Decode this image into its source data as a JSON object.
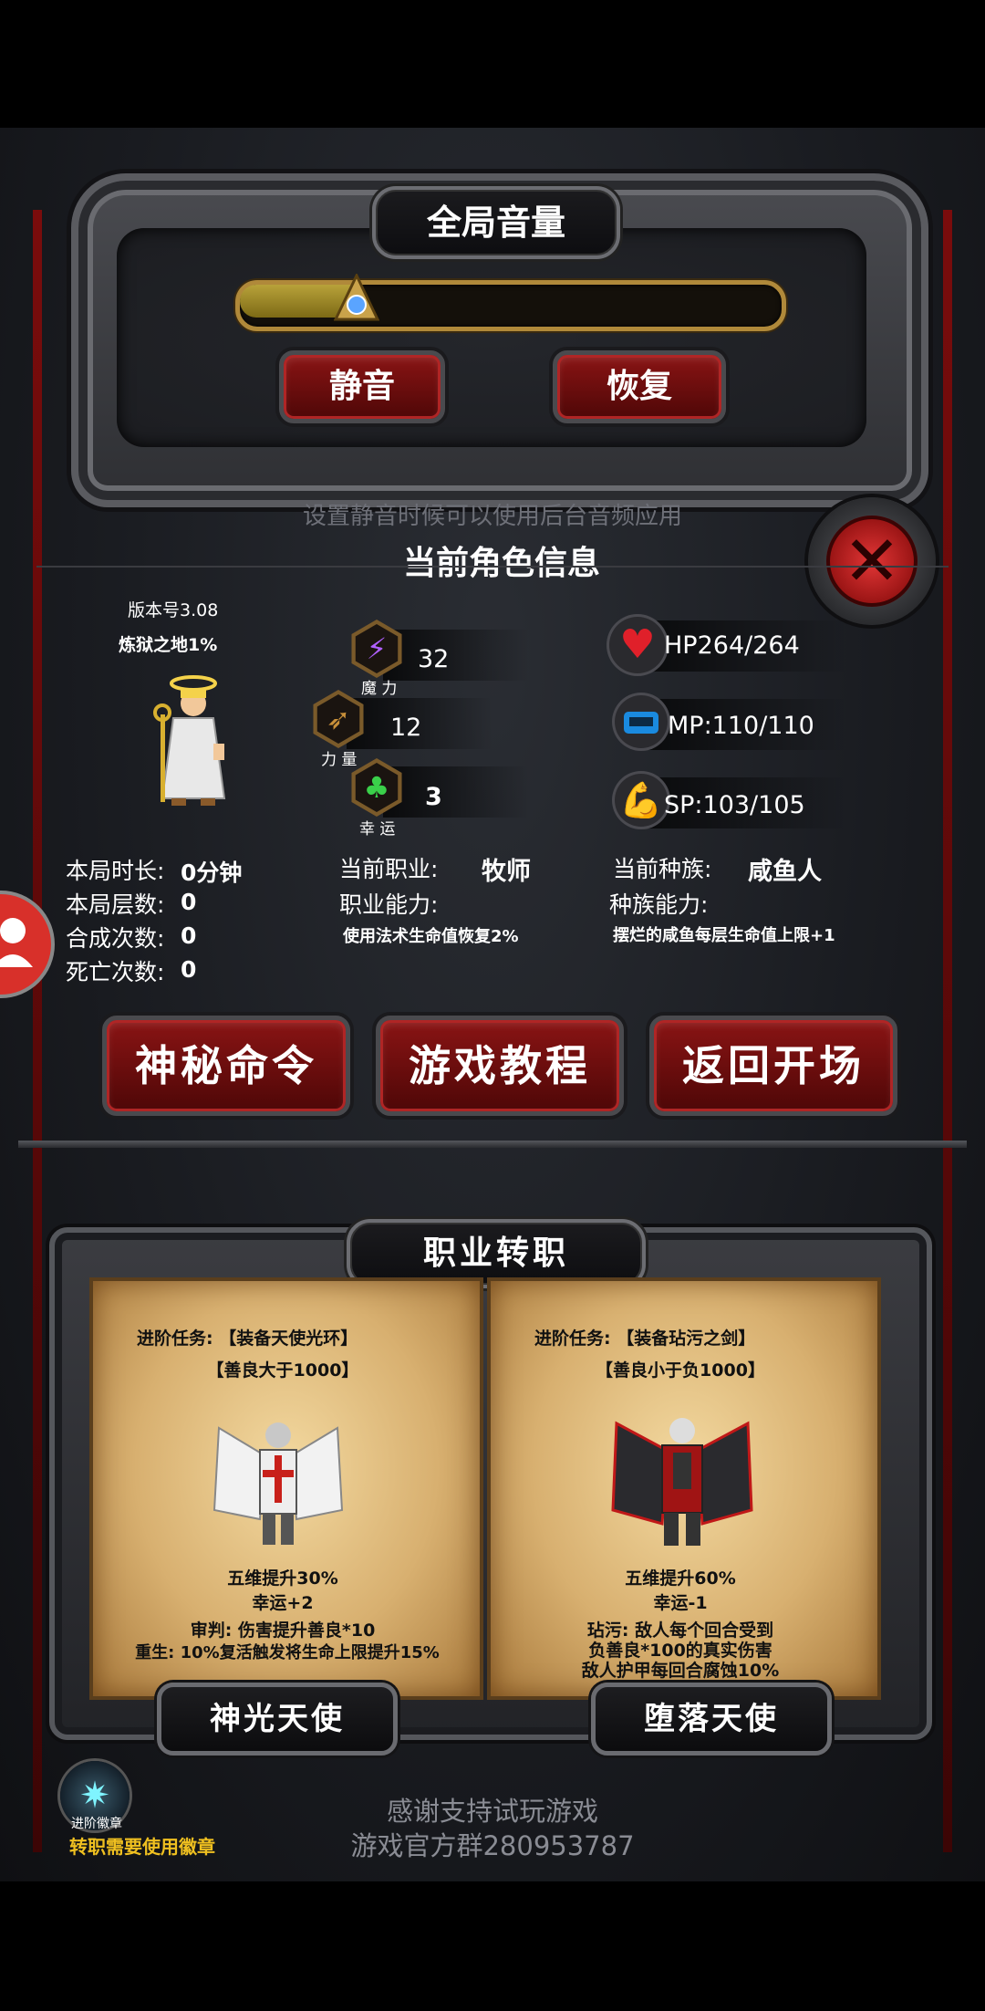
{
  "volume": {
    "title": "全局音量",
    "level": 0.22,
    "mute_label": "静音",
    "restore_label": "恢复",
    "hint": "设置静音时候可以使用后台音频应用"
  },
  "char_info": {
    "title": "当前角色信息",
    "version": "版本号3.08",
    "difficulty": "炼狱之地1%",
    "stats": {
      "magic": {
        "value": "32",
        "label": "魔 力",
        "icon": "lightning-icon"
      },
      "strength": {
        "value": "12",
        "label": "力 量",
        "icon": "bow-icon"
      },
      "luck": {
        "value": "3",
        "label": "幸 运",
        "icon": "clover-icon"
      },
      "hp": {
        "value": "HP264/264",
        "icon": "heart-icon"
      },
      "mp": {
        "value": "MP:110/110",
        "icon": "mp-icon"
      },
      "sp": {
        "value": "SP:103/105",
        "icon": "muscle-icon"
      }
    },
    "records": [
      {
        "label": "本局时长:",
        "value": "0分钟"
      },
      {
        "label": "本局层数:",
        "value": "0"
      },
      {
        "label": "合成次数:",
        "value": "0"
      },
      {
        "label": "死亡次数:",
        "value": "0"
      }
    ],
    "job": {
      "label": "当前职业:",
      "value": "牧师",
      "ability_label": "职业能力:",
      "ability": "使用法术生命值恢复2%"
    },
    "race": {
      "label": "当前种族:",
      "value": "咸鱼人",
      "ability_label": "种族能力:",
      "ability": "摆烂的咸鱼每层生命值上限+1"
    }
  },
  "buttons": {
    "secret": "神秘命令",
    "tutorial": "游戏教程",
    "back": "返回开场"
  },
  "class_change": {
    "title": "职业转职",
    "cards": [
      {
        "quest": "进阶任务: 【装备天使光环】",
        "condition": "【善良大于1000】",
        "bonus1": "五维提升30%",
        "bonus2": "幸运+2",
        "effect1": "审判: 伤害提升善良*10",
        "effect2": "重生: 10%复活触发将生命上限提升15%",
        "name": "神光天使"
      },
      {
        "quest": "进阶任务: 【装备玷污之剑】",
        "condition": "【善良小于负1000】",
        "bonus1": "五维提升60%",
        "bonus2": "幸运-1",
        "effect1": "玷污: 敌人每个回合受到",
        "effect2": "负善良*100的真实伤害",
        "effect3": "敌人护甲每回合腐蚀10%",
        "name": "堕落天使"
      }
    ]
  },
  "footer": {
    "thanks": "感谢支持试玩游戏",
    "group": "游戏官方群280953787",
    "badge_label": "进阶徽章",
    "badge_note": "转职需要使用徽章"
  }
}
